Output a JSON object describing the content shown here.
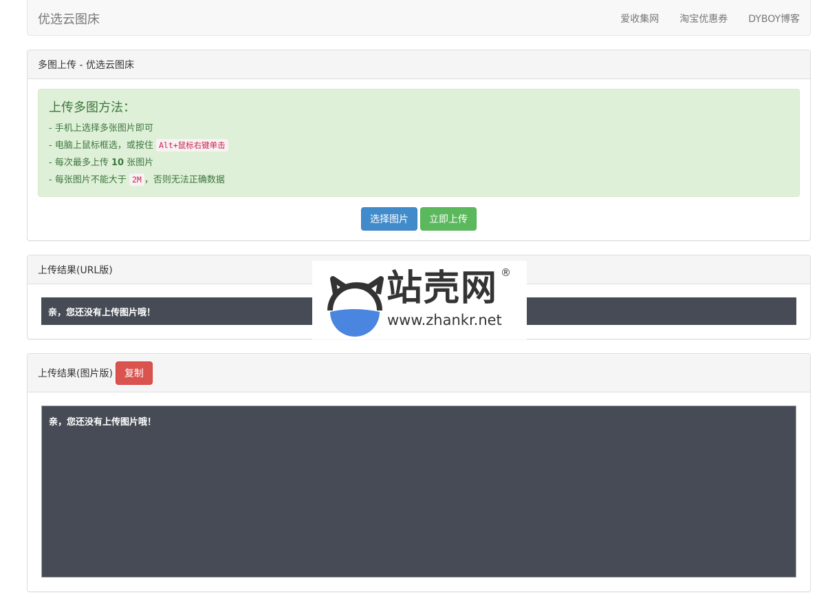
{
  "navbar": {
    "brand": "优选云图床",
    "links": [
      "爱收集网",
      "淘宝优惠券",
      "DYBOY博客"
    ]
  },
  "upload_panel": {
    "heading": "多图上传 - 优选云图床",
    "alert": {
      "title": "上传多图方法：",
      "line1": "- 手机上选择多张图片即可",
      "line2_prefix": "- 电脑上鼠标框选，或按住 ",
      "line2_code": "Alt+鼠标右键单击",
      "line3_prefix": "- 每次最多上传 ",
      "line3_bold": "10",
      "line3_suffix": " 张图片",
      "line4_prefix": "- 每张图片不能大于 ",
      "line4_code": "2M",
      "line4_suffix": "，否则无法正确数据"
    },
    "select_button": "选择图片",
    "upload_button": "立即上传"
  },
  "url_panel": {
    "heading": "上传结果(URL版)",
    "result": "亲，您还没有上传图片哦！"
  },
  "image_panel": {
    "heading": "上传结果(图片版)",
    "copy_button": "复制",
    "result": "亲，您还没有上传图片哦！"
  },
  "watermark": {
    "text": "站壳网",
    "url": "www.zhankr.net",
    "reg": "®"
  },
  "colors": {
    "primary": "#428bca",
    "success": "#5cb85c",
    "danger": "#d9534f",
    "result_bg": "#464b56",
    "alert_bg": "#dff0d8"
  }
}
